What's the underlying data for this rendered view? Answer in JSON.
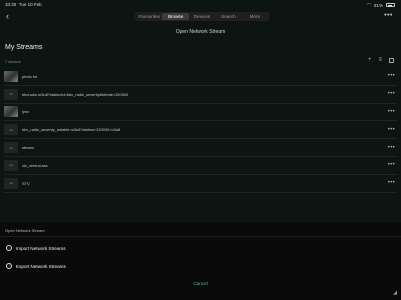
{
  "status": {
    "time": "10:30",
    "date": "Tue 10 Feb",
    "battery": "81%"
  },
  "nav": {
    "back": "‹",
    "more": "•••",
    "tabs": [
      {
        "label": "Favourites",
        "active": false
      },
      {
        "label": "Browse",
        "active": true
      },
      {
        "label": "Devices",
        "active": false
      },
      {
        "label": "Search",
        "active": false
      },
      {
        "label": "More",
        "active": false
      }
    ],
    "subtitle": "Open Network Stream"
  },
  "streams": {
    "title": "My Streams",
    "count": "7 streams",
    "tools": {
      "add": "+",
      "filter": "≡"
    },
    "items": [
      {
        "label": "photo for",
        "thumb": "img"
      },
      {
        "label": "bbcradio.m3u8?stationId=bbc_radio_seventy&bitrate=320000",
        "thumb": "n/a"
      },
      {
        "label": "lynx",
        "thumb": "img"
      },
      {
        "label": "bbc_radio_seventy_notable.m3u8?station=320000.m3u8",
        "thumb": "n/a"
      },
      {
        "label": "stream",
        "thumb": "n/a"
      },
      {
        "label": "vlc_central.asx",
        "thumb": "n/a"
      },
      {
        "label": "STV",
        "thumb": "n/a"
      }
    ]
  },
  "sheet": {
    "title": "Open Network Stream",
    "import_label": "Import Network Streams",
    "export_label": "Export Network Streams",
    "cancel_label": "Cancel"
  },
  "colors": {
    "accent": "#4db8a0",
    "background": "#0c1512"
  }
}
